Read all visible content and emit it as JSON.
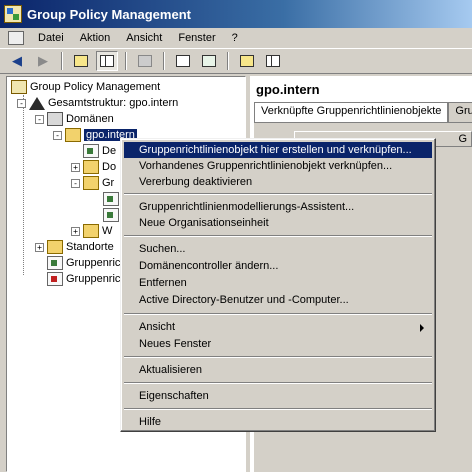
{
  "window": {
    "title": "Group Policy Management"
  },
  "menubar": {
    "items": [
      "Datei",
      "Aktion",
      "Ansicht",
      "Fenster",
      "?"
    ]
  },
  "tree": {
    "root": "Group Policy Management",
    "forest": "Gesamtstruktur: gpo.intern",
    "domains": "Domänen",
    "domain": "gpo.intern",
    "children": [
      "De",
      "Do",
      "Gr",
      "W"
    ],
    "sites": "Standorte",
    "gpm1": "Gruppenric",
    "gpm2": "Gruppenric"
  },
  "right": {
    "header": "gpo.intern",
    "tabs": [
      "Verknüpfte Gruppenrichtlinienobjekte",
      "Grup"
    ],
    "column_fragment": "G"
  },
  "context_menu": {
    "groups": [
      [
        "Gruppenrichtlinienobjekt hier erstellen und verknüpfen...",
        "Vorhandenes Gruppenrichtlinienobjekt verknüpfen...",
        "Vererbung deaktivieren"
      ],
      [
        "Gruppenrichtlinienmodellierungs-Assistent...",
        "Neue Organisationseinheit"
      ],
      [
        "Suchen...",
        "Domänencontroller ändern...",
        "Entfernen",
        "Active Directory-Benutzer und -Computer..."
      ],
      [
        "Ansicht",
        "Neues Fenster"
      ],
      [
        "Aktualisieren"
      ],
      [
        "Eigenschaften"
      ],
      [
        "Hilfe"
      ]
    ]
  }
}
